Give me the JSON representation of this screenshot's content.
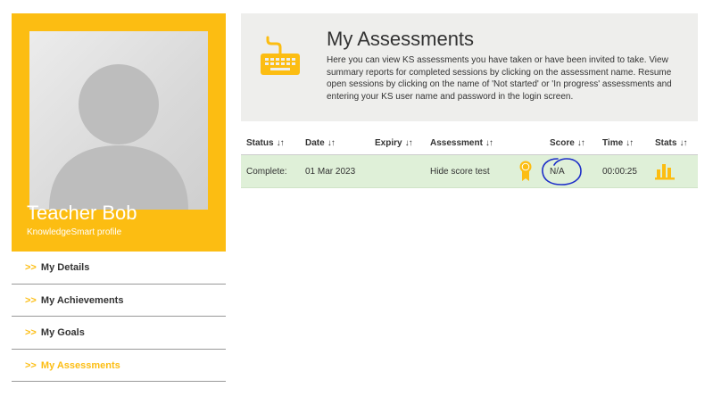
{
  "profile": {
    "name": "Teacher Bob",
    "subtitle": "KnowledgeSmart profile",
    "accent": "#fcbd12"
  },
  "menu": {
    "arrow": ">>",
    "items": [
      {
        "label": "My Details",
        "active": false
      },
      {
        "label": "My Achievements",
        "active": false
      },
      {
        "label": "My Goals",
        "active": false
      },
      {
        "label": "My Assessments",
        "active": true
      }
    ]
  },
  "header": {
    "title": "My Assessments",
    "intro": "Here you can view KS assessments you have taken or have been invited to take. View summary reports for completed sessions by clicking on the assessment name. Resume open sessions by clicking on the name of 'Not started' or 'In progress' assessments and entering your KS user name and password in the login screen.",
    "icon": "keyboard-icon"
  },
  "table": {
    "sort_glyph": "↓↑",
    "columns": [
      "Status",
      "Date",
      "Expiry",
      "Assessment",
      "Score",
      "Time",
      "Stats"
    ],
    "rows": [
      {
        "status": "Complete:",
        "date": "01 Mar 2023",
        "expiry": "",
        "assessment": "Hide score test",
        "award_icon": "award-ribbon-icon",
        "score": "N/A",
        "time": "00:00:25",
        "stats_icon": "bar-chart-icon"
      }
    ]
  }
}
